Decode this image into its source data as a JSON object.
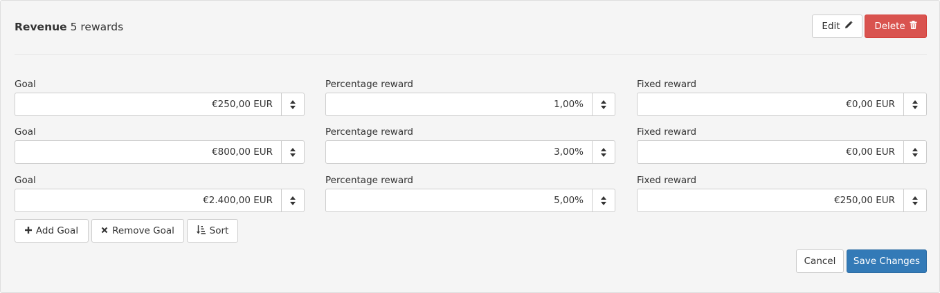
{
  "header": {
    "title_strong": "Revenue",
    "title_rest": "5 rewards",
    "edit_label": "Edit",
    "delete_label": "Delete"
  },
  "labels": {
    "goal": "Goal",
    "percentage": "Percentage reward",
    "fixed": "Fixed reward"
  },
  "rows": [
    {
      "goal": "€250,00 EUR",
      "percentage": "1,00%",
      "fixed": "€0,00 EUR"
    },
    {
      "goal": "€800,00 EUR",
      "percentage": "3,00%",
      "fixed": "€0,00 EUR"
    },
    {
      "goal": "€2.400,00 EUR",
      "percentage": "5,00%",
      "fixed": "€250,00 EUR"
    }
  ],
  "actions": {
    "add_goal": "Add Goal",
    "remove_goal": "Remove Goal",
    "sort": "Sort"
  },
  "footer": {
    "cancel": "Cancel",
    "save": "Save Changes"
  },
  "icons": {
    "edit": "pencil-icon",
    "delete": "trash-icon",
    "add": "plus-icon",
    "remove": "times-icon",
    "sort": "sort-amount-icon",
    "spinner": "chevron-up-down-icon"
  },
  "colors": {
    "danger": "#d9534f",
    "primary": "#337ab7"
  }
}
